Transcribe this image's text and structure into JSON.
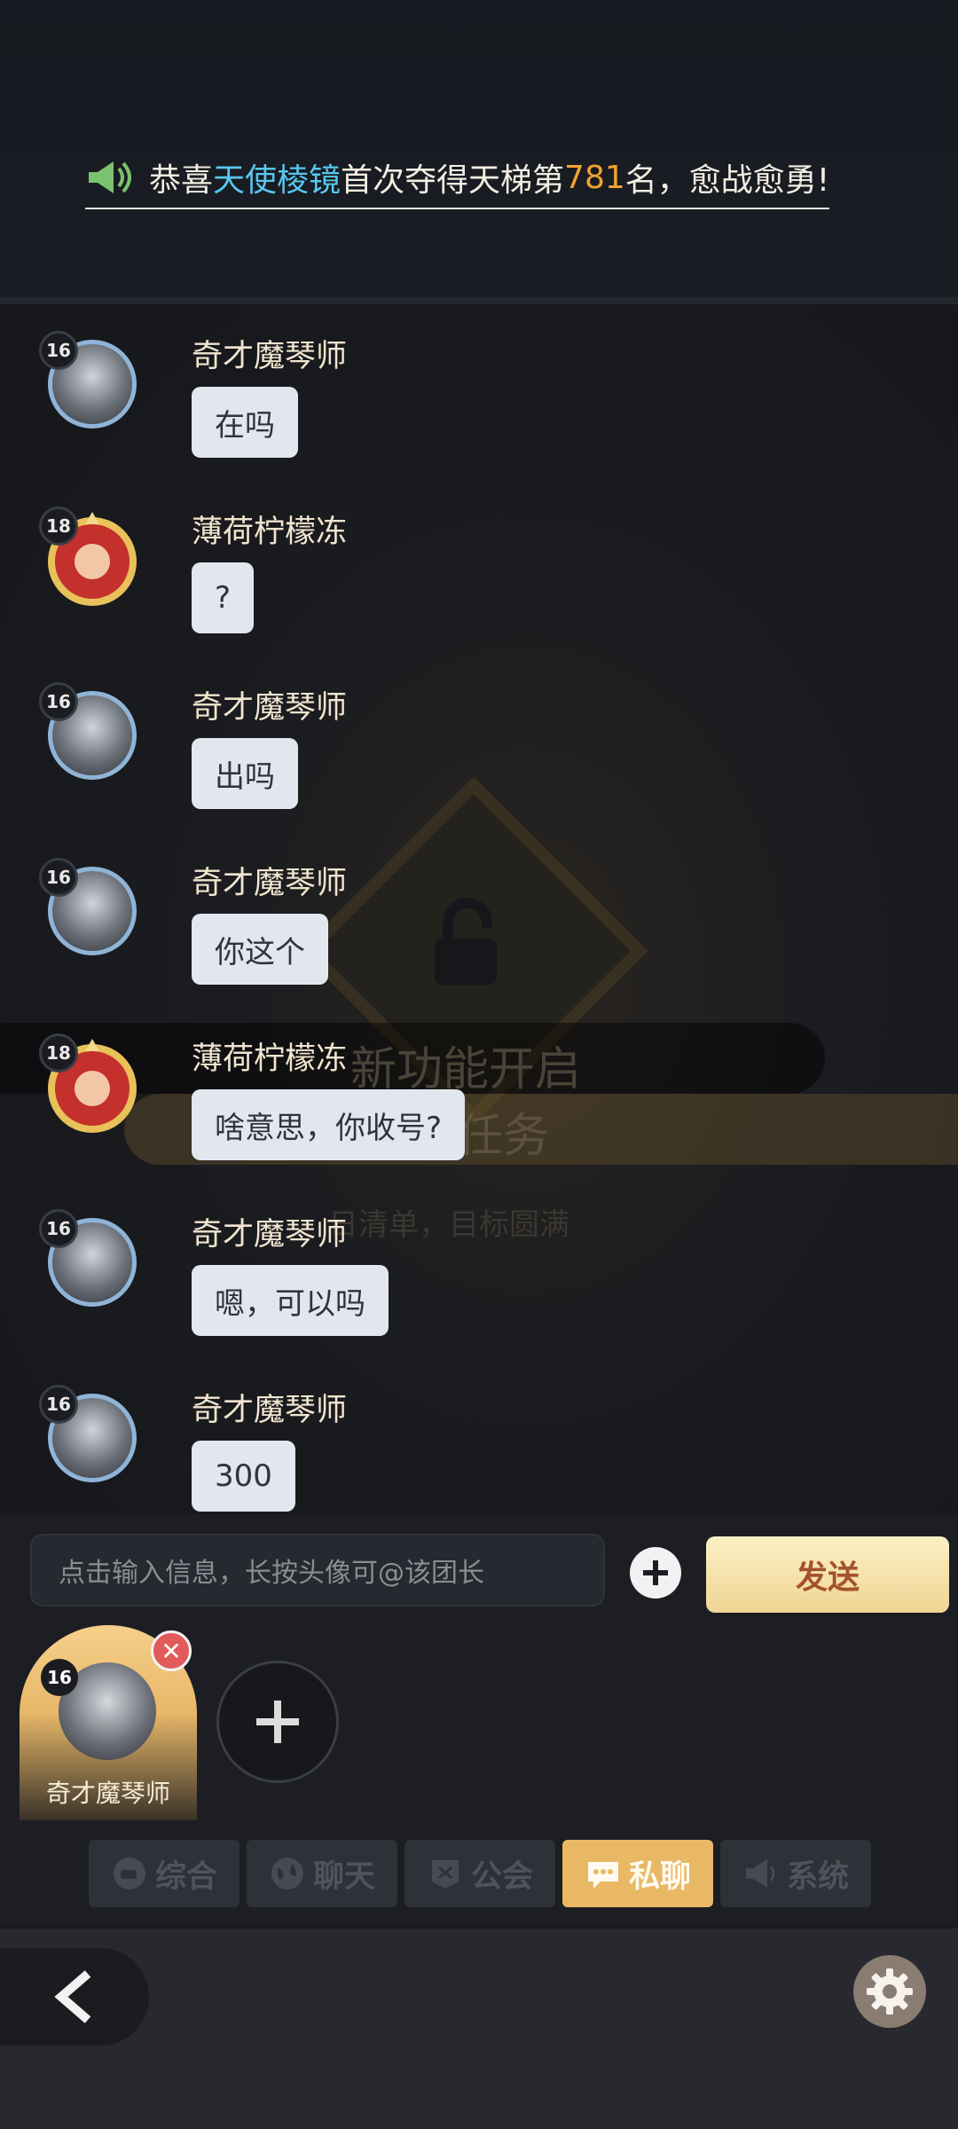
{
  "announcement": {
    "prefix": "恭喜",
    "player": "天使棱镜",
    "middle": "首次夺得天梯第",
    "rank": "781",
    "suffix": "名，愈战愈勇!"
  },
  "background_banner": {
    "title": "新功能开启",
    "subtitle": "任务",
    "desc": "日清单，目标圆满"
  },
  "messages": [
    {
      "level": "16",
      "name": "奇才魔琴师",
      "text": "在吗"
    },
    {
      "level": "18",
      "name": "薄荷柠檬冻",
      "text": "?"
    },
    {
      "level": "16",
      "name": "奇才魔琴师",
      "text": "出吗"
    },
    {
      "level": "16",
      "name": "奇才魔琴师",
      "text": "你这个"
    },
    {
      "level": "18",
      "name": "薄荷柠檬冻",
      "text": "啥意思，你收号?"
    },
    {
      "level": "16",
      "name": "奇才魔琴师",
      "text": "嗯，可以吗"
    },
    {
      "level": "16",
      "name": "奇才魔琴师",
      "text": "300"
    }
  ],
  "input": {
    "placeholder": "点击输入信息，长按头像可@该团长",
    "send_label": "发送"
  },
  "contacts": [
    {
      "level": "16",
      "name": "奇才魔琴师"
    }
  ],
  "tabs": [
    {
      "label": "综合",
      "icon": "teacup-icon",
      "active": false
    },
    {
      "label": "聊天",
      "icon": "globe-icon",
      "active": false
    },
    {
      "label": "公会",
      "icon": "guild-banner-icon",
      "active": false
    },
    {
      "label": "私聊",
      "icon": "chat-bubble-icon",
      "active": true
    },
    {
      "label": "系统",
      "icon": "megaphone-icon",
      "active": false
    }
  ],
  "colors": {
    "accent_gold": "#e9b864",
    "player_name": "#58c7ef",
    "rank_number": "#f0a332"
  }
}
